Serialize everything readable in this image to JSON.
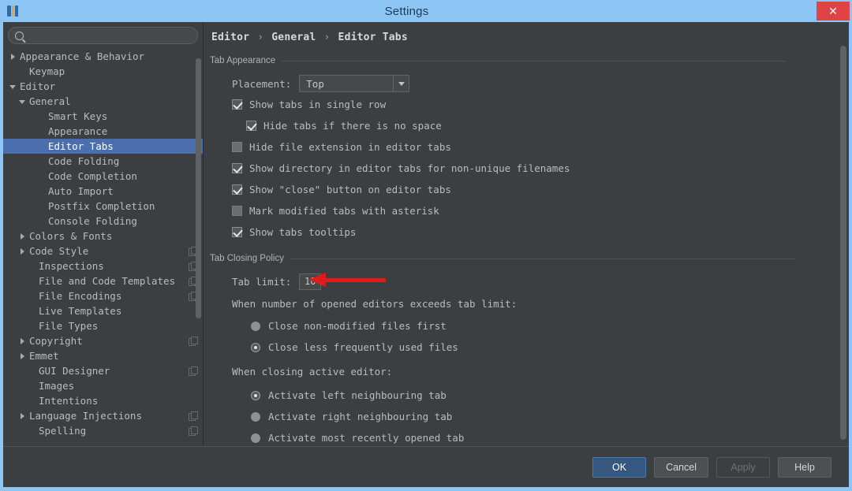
{
  "window": {
    "title": "Settings",
    "app_icon": "intellij-logo-icon",
    "close_label": "✕"
  },
  "sidebar": {
    "search": {
      "value": "",
      "placeholder": "",
      "icon": "search-icon"
    },
    "items": [
      {
        "label": "Appearance & Behavior",
        "indent": 0,
        "arrow": "collapsed",
        "selected": false,
        "copy": false
      },
      {
        "label": "Keymap",
        "indent": 1,
        "arrow": "none",
        "selected": false,
        "copy": false
      },
      {
        "label": "Editor",
        "indent": 0,
        "arrow": "expanded",
        "selected": false,
        "copy": false
      },
      {
        "label": "General",
        "indent": 1,
        "arrow": "expanded",
        "selected": false,
        "copy": false
      },
      {
        "label": "Smart Keys",
        "indent": 3,
        "arrow": "none",
        "selected": false,
        "copy": false
      },
      {
        "label": "Appearance",
        "indent": 3,
        "arrow": "none",
        "selected": false,
        "copy": false
      },
      {
        "label": "Editor Tabs",
        "indent": 3,
        "arrow": "none",
        "selected": true,
        "copy": false
      },
      {
        "label": "Code Folding",
        "indent": 3,
        "arrow": "none",
        "selected": false,
        "copy": false
      },
      {
        "label": "Code Completion",
        "indent": 3,
        "arrow": "none",
        "selected": false,
        "copy": false
      },
      {
        "label": "Auto Import",
        "indent": 3,
        "arrow": "none",
        "selected": false,
        "copy": false
      },
      {
        "label": "Postfix Completion",
        "indent": 3,
        "arrow": "none",
        "selected": false,
        "copy": false
      },
      {
        "label": "Console Folding",
        "indent": 3,
        "arrow": "none",
        "selected": false,
        "copy": false
      },
      {
        "label": "Colors & Fonts",
        "indent": 1,
        "arrow": "collapsed",
        "selected": false,
        "copy": false
      },
      {
        "label": "Code Style",
        "indent": 1,
        "arrow": "collapsed",
        "selected": false,
        "copy": true
      },
      {
        "label": "Inspections",
        "indent": 2,
        "arrow": "none",
        "selected": false,
        "copy": true
      },
      {
        "label": "File and Code Templates",
        "indent": 2,
        "arrow": "none",
        "selected": false,
        "copy": true
      },
      {
        "label": "File Encodings",
        "indent": 2,
        "arrow": "none",
        "selected": false,
        "copy": true
      },
      {
        "label": "Live Templates",
        "indent": 2,
        "arrow": "none",
        "selected": false,
        "copy": false
      },
      {
        "label": "File Types",
        "indent": 2,
        "arrow": "none",
        "selected": false,
        "copy": false
      },
      {
        "label": "Copyright",
        "indent": 1,
        "arrow": "collapsed",
        "selected": false,
        "copy": true
      },
      {
        "label": "Emmet",
        "indent": 1,
        "arrow": "collapsed",
        "selected": false,
        "copy": false
      },
      {
        "label": "GUI Designer",
        "indent": 2,
        "arrow": "none",
        "selected": false,
        "copy": true
      },
      {
        "label": "Images",
        "indent": 2,
        "arrow": "none",
        "selected": false,
        "copy": false
      },
      {
        "label": "Intentions",
        "indent": 2,
        "arrow": "none",
        "selected": false,
        "copy": false
      },
      {
        "label": "Language Injections",
        "indent": 1,
        "arrow": "collapsed",
        "selected": false,
        "copy": true
      },
      {
        "label": "Spelling",
        "indent": 2,
        "arrow": "none",
        "selected": false,
        "copy": true
      }
    ]
  },
  "main": {
    "breadcrumb": {
      "part1": "Editor",
      "part2": "General",
      "part3": "Editor Tabs",
      "separator": "›"
    },
    "tab_appearance": {
      "section_title": "Tab Appearance",
      "placement_label": "Placement:",
      "placement_value": "Top",
      "checkboxes": [
        {
          "label": "Show tabs in single row",
          "checked": true,
          "indent": 1
        },
        {
          "label": "Hide tabs if there is no space",
          "checked": true,
          "indent": 2
        },
        {
          "label": "Hide file extension in editor tabs",
          "checked": false,
          "indent": 1
        },
        {
          "label": "Show directory in editor tabs for non-unique filenames",
          "checked": true,
          "indent": 1
        },
        {
          "label": "Show \"close\" button on editor tabs",
          "checked": true,
          "indent": 1
        },
        {
          "label": "Mark modified tabs with asterisk",
          "checked": false,
          "indent": 1
        },
        {
          "label": "Show tabs tooltips",
          "checked": true,
          "indent": 1
        }
      ]
    },
    "tab_closing_policy": {
      "section_title": "Tab Closing Policy",
      "tab_limit_label": "Tab limit:",
      "tab_limit_value": "10",
      "annotation_arrow": {
        "color": "#e01b1b",
        "points_to": "tab-limit-input"
      },
      "exceeds_label": "When number of opened editors exceeds tab limit:",
      "exceeds_options": [
        {
          "label": "Close non-modified files first",
          "selected": false
        },
        {
          "label": "Close less frequently used files",
          "selected": true
        }
      ],
      "closing_label": "When closing active editor:",
      "closing_options": [
        {
          "label": "Activate left neighbouring tab",
          "selected": true
        },
        {
          "label": "Activate right neighbouring tab",
          "selected": false
        },
        {
          "label": "Activate most recently opened tab",
          "selected": false
        }
      ]
    }
  },
  "buttons": {
    "ok": "OK",
    "cancel": "Cancel",
    "apply": "Apply",
    "help": "Help"
  },
  "colors": {
    "titlebar": "#8dc6f5",
    "panel": "#3c3f41",
    "selection": "#4b6eaf",
    "accent_button": "#365880",
    "close_button": "#e04343",
    "annotation": "#e01b1b"
  }
}
